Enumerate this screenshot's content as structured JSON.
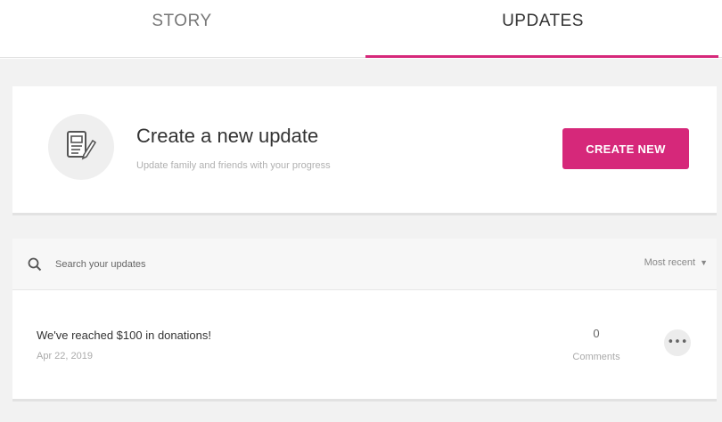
{
  "tabs": {
    "story": "STORY",
    "updates": "UPDATES"
  },
  "create": {
    "title": "Create a new update",
    "subtitle": "Update family and friends with your progress",
    "button": "CREATE NEW",
    "icon": "document-edit-icon"
  },
  "search": {
    "placeholder": "Search your updates",
    "icon": "search-icon"
  },
  "sort": {
    "label": "Most recent",
    "icon": "caret-down-icon"
  },
  "updates": [
    {
      "title": "We've reached $100 in donations!",
      "date": "Apr 22, 2019",
      "comment_count": "0",
      "comment_label": "Comments",
      "more_icon": "more-horizontal-icon"
    }
  ],
  "colors": {
    "accent": "#d6287a",
    "background": "#f2f2f2"
  }
}
